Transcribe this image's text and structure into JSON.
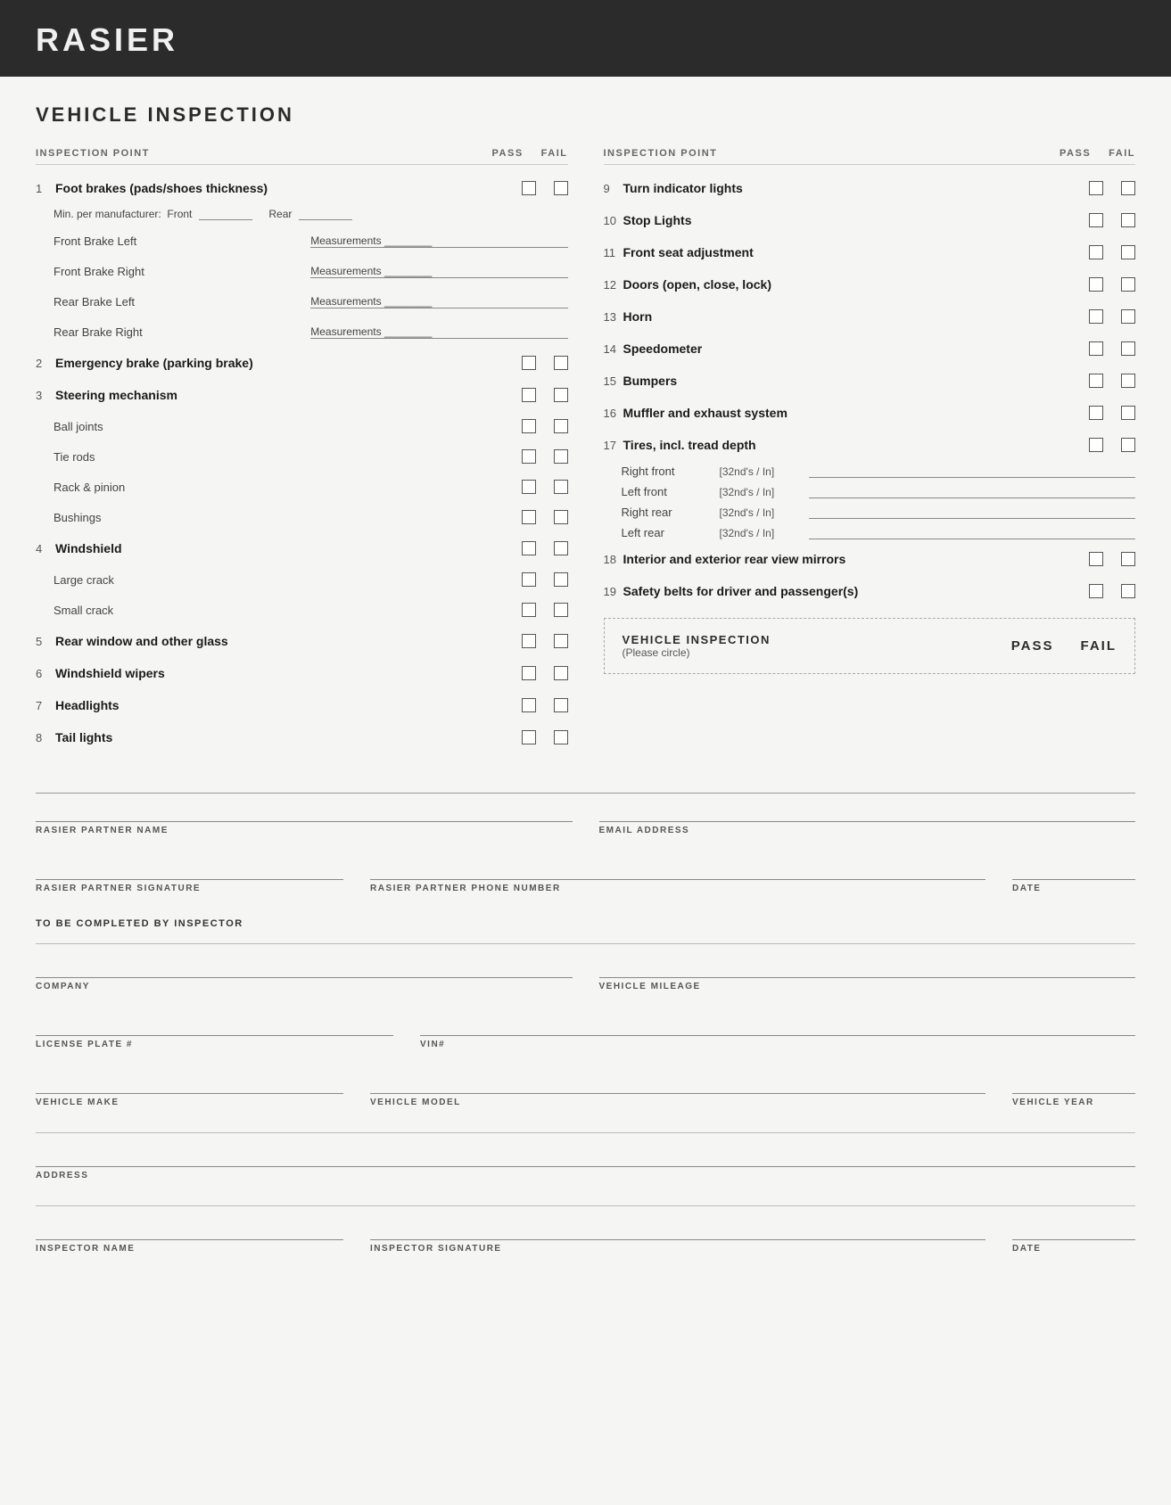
{
  "header": {
    "title": "RASIER"
  },
  "main": {
    "section_title": "VEHICLE INSPECTION",
    "col_headers": {
      "inspection_point": "INSPECTION POINT",
      "pass": "PASS",
      "fail": "FAIL"
    },
    "left_items": [
      {
        "number": "1",
        "label": "Foot brakes (pads/shoes thickness)",
        "bold": true,
        "has_checkboxes": true,
        "sub_items": [
          {
            "type": "min_per",
            "text": "Min. per manufacturer:  Front ______    Rear ______"
          },
          {
            "type": "measurement",
            "label": "Front Brake Left",
            "value": "Measurements ________"
          },
          {
            "type": "measurement",
            "label": "Front Brake Right",
            "value": "Measurements ________"
          },
          {
            "type": "measurement",
            "label": "Rear Brake Left",
            "value": "Measurements ________"
          },
          {
            "type": "measurement",
            "label": "Rear Brake Right",
            "value": "Measurements ________"
          }
        ]
      },
      {
        "number": "2",
        "label": "Emergency brake (parking brake)",
        "bold": true,
        "has_checkboxes": true
      },
      {
        "number": "3",
        "label": "Steering mechanism",
        "bold": true,
        "has_checkboxes": true,
        "sub_items": [
          {
            "type": "check",
            "label": "Ball joints"
          },
          {
            "type": "check",
            "label": "Tie rods"
          },
          {
            "type": "check",
            "label": "Rack & pinion"
          },
          {
            "type": "check",
            "label": "Bushings"
          }
        ]
      },
      {
        "number": "4",
        "label": "Windshield",
        "bold": true,
        "has_checkboxes": true,
        "sub_items": [
          {
            "type": "check",
            "label": "Large crack"
          },
          {
            "type": "check",
            "label": "Small crack"
          }
        ]
      },
      {
        "number": "5",
        "label": "Rear window and other glass",
        "bold": true,
        "has_checkboxes": true
      },
      {
        "number": "6",
        "label": "Windshield wipers",
        "bold": true,
        "has_checkboxes": true
      },
      {
        "number": "7",
        "label": "Headlights",
        "bold": true,
        "has_checkboxes": true
      },
      {
        "number": "8",
        "label": "Tail lights",
        "bold": true,
        "has_checkboxes": true
      }
    ],
    "right_items": [
      {
        "number": "9",
        "label": "Turn indicator lights",
        "bold": true,
        "has_checkboxes": true
      },
      {
        "number": "10",
        "label": "Stop Lights",
        "bold": true,
        "has_checkboxes": true
      },
      {
        "number": "11",
        "label": "Front seat adjustment",
        "bold": true,
        "has_checkboxes": true
      },
      {
        "number": "12",
        "label": "Doors (open, close, lock)",
        "bold": true,
        "has_checkboxes": true
      },
      {
        "number": "13",
        "label": "Horn",
        "bold": true,
        "has_checkboxes": true
      },
      {
        "number": "14",
        "label": "Speedometer",
        "bold": true,
        "has_checkboxes": true
      },
      {
        "number": "15",
        "label": "Bumpers",
        "bold": true,
        "has_checkboxes": true
      },
      {
        "number": "16",
        "label": "Muffler and exhaust system",
        "bold": true,
        "has_checkboxes": true
      },
      {
        "number": "17",
        "label": "Tires, incl. tread depth",
        "bold": true,
        "has_checkboxes": true,
        "sub_items": [
          {
            "type": "tire",
            "label": "Right front",
            "unit": "[32nd's / In]"
          },
          {
            "type": "tire",
            "label": "Left front",
            "unit": "[32nd's / In]"
          },
          {
            "type": "tire",
            "label": "Right rear",
            "unit": "[32nd's / In]"
          },
          {
            "type": "tire",
            "label": "Left rear",
            "unit": "[32nd's / In]"
          }
        ]
      },
      {
        "number": "18",
        "label": "Interior and exterior rear view mirrors",
        "bold": true,
        "has_checkboxes": true
      },
      {
        "number": "19",
        "label": "Safety belts for driver and passenger(s)",
        "bold": true,
        "has_checkboxes": true
      }
    ],
    "dashed_box": {
      "title": "VEHICLE INSPECTION",
      "subtitle": "(Please circle)",
      "pass": "PASS",
      "fail": "FAIL"
    },
    "form": {
      "partner_name_label": "RASIER PARTNER NAME",
      "email_label": "EMAIL ADDRESS",
      "signature_label": "RASIER PARTNER SIGNATURE",
      "phone_label": "RASIER PARTNER PHONE NUMBER",
      "date_label": "DATE",
      "inspector_section_label": "TO BE COMPLETED BY INSPECTOR",
      "company_label": "COMPANY",
      "mileage_label": "VEHICLE MILEAGE",
      "plate_label": "LICENSE PLATE #",
      "vin_label": "VIN#",
      "make_label": "VEHICLE MAKE",
      "model_label": "VEHICLE MODEL",
      "year_label": "VEHICLE YEAR",
      "address_label": "ADDRESS",
      "inspector_name_label": "INSPECTOR NAME",
      "inspector_sig_label": "INSPECTOR SIGNATURE",
      "inspector_date_label": "DATE"
    }
  }
}
